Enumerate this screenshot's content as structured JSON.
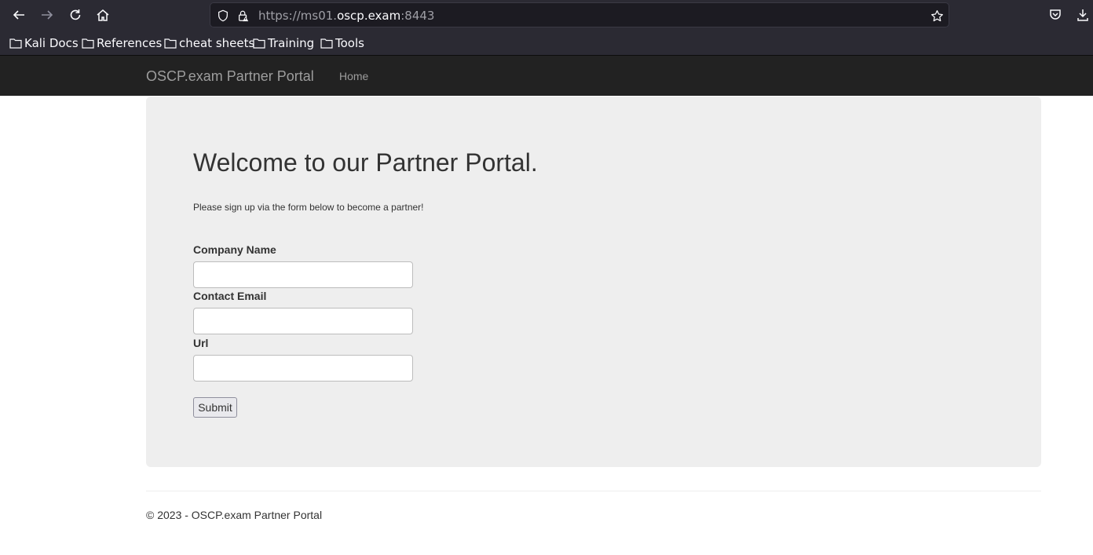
{
  "browser": {
    "url_prefix": "https://ms01.",
    "url_host": "oscp.exam",
    "url_suffix": ":8443",
    "bookmarks": [
      {
        "label": "Kali Docs"
      },
      {
        "label": "References"
      },
      {
        "label": "cheat sheets"
      },
      {
        "label": "Training"
      },
      {
        "label": "Tools"
      }
    ]
  },
  "navbar": {
    "brand": "OSCP.exam Partner Portal",
    "home": "Home"
  },
  "main": {
    "title": "Welcome to our Partner Portal.",
    "lead": "Please sign up via the form below to become a partner!",
    "form": {
      "company_label": "Company Name",
      "company_value": "",
      "email_label": "Contact Email",
      "email_value": "",
      "url_label": "Url",
      "url_value": "",
      "submit": "Submit"
    }
  },
  "footer": {
    "text": "© 2023 - OSCP.exam Partner Portal"
  }
}
